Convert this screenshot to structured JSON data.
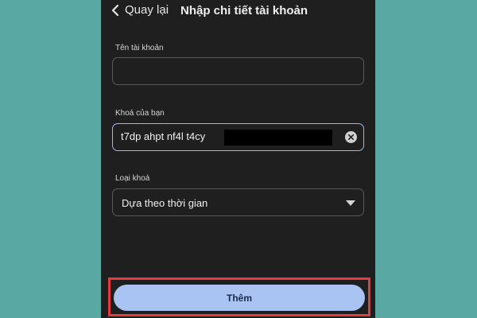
{
  "header": {
    "back_label": "Quay lại",
    "title": "Nhập chi tiết tài khoản"
  },
  "account_name": {
    "label": "Tên tài khoản",
    "value": ""
  },
  "secret_key": {
    "label": "Khoá của bạn",
    "value": "t7dp ahpt nf4l t4cy"
  },
  "key_type": {
    "label": "Loại khoá",
    "selected": "Dựa theo thời gian"
  },
  "add_button": {
    "label": "Thêm"
  },
  "colors": {
    "background": "#5aa8a4",
    "screen": "#1f1f1f",
    "focus_border": "#9db8e6",
    "button": "#a9c4f2",
    "highlight": "#e53a40"
  }
}
